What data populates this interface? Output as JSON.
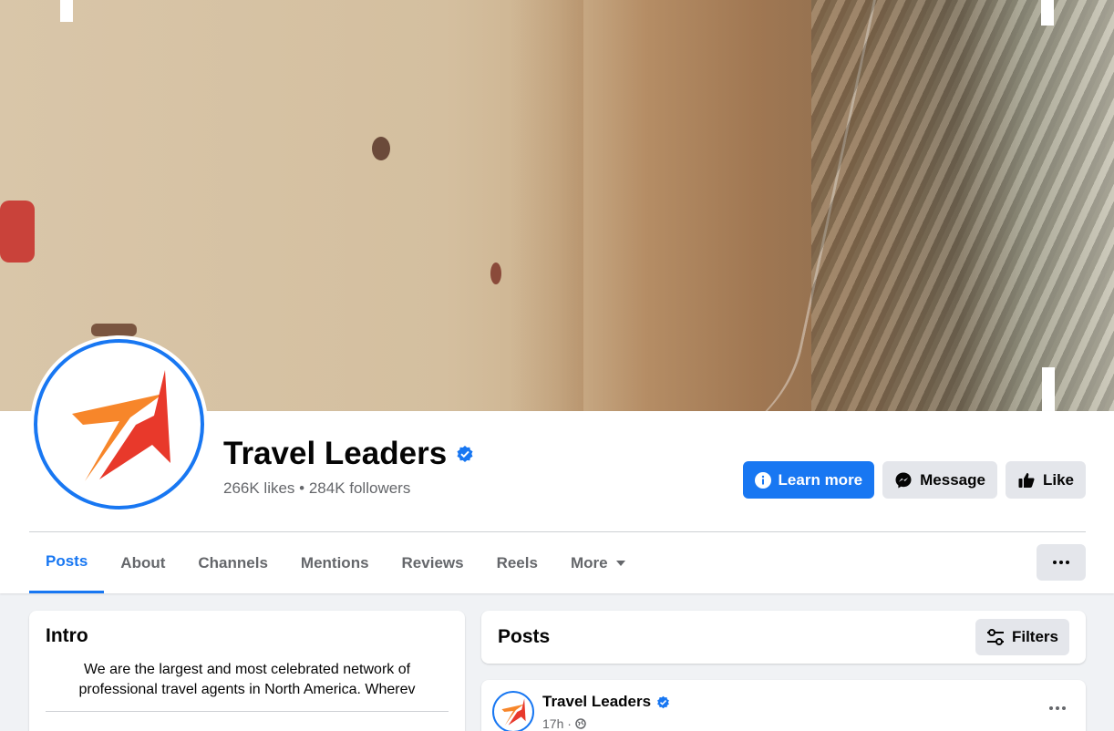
{
  "page": {
    "name": "Travel Leaders",
    "stats": "266K likes • 284K followers",
    "colors": {
      "accent": "#1877f2",
      "logo_orange": "#f7862a",
      "logo_red": "#e8392b"
    }
  },
  "actions": {
    "learn_more": "Learn more",
    "message": "Message",
    "like": "Like"
  },
  "tabs": [
    {
      "label": "Posts",
      "active": true
    },
    {
      "label": "About"
    },
    {
      "label": "Channels"
    },
    {
      "label": "Mentions"
    },
    {
      "label": "Reviews"
    },
    {
      "label": "Reels"
    },
    {
      "label": "More"
    }
  ],
  "intro": {
    "title": "Intro",
    "text": "We are the largest and most celebrated network of professional travel agents in North America. Wherev"
  },
  "posts": {
    "title": "Posts",
    "filters_label": "Filters",
    "items": [
      {
        "author": "Travel Leaders",
        "time": "17h ·"
      }
    ]
  }
}
